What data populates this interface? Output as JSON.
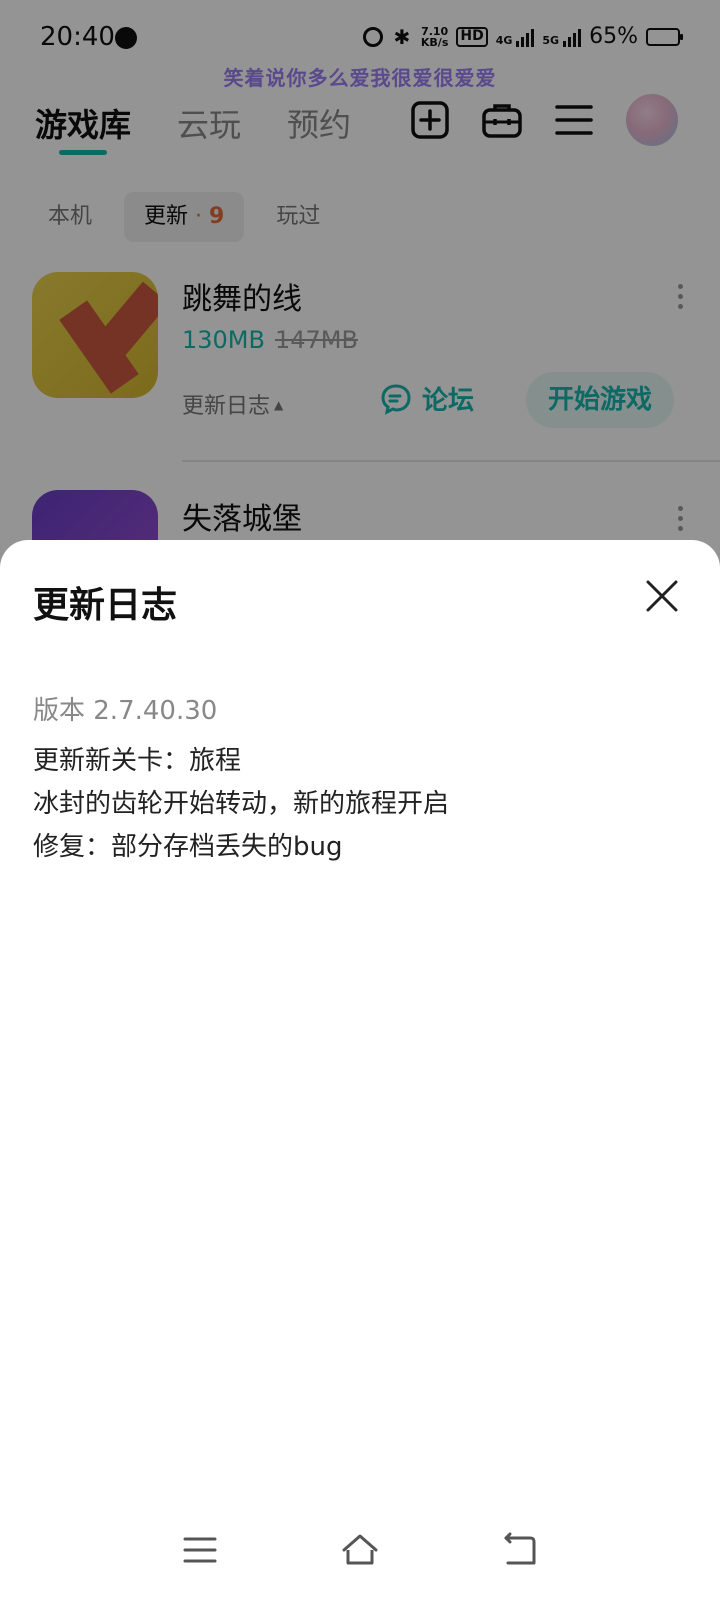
{
  "status_bar": {
    "time": "20:40",
    "network_speed_value": "7.10",
    "network_speed_unit": "KB/s",
    "hd_label": "HD",
    "sim1_label": "4G",
    "sim2_label": "5G",
    "battery_percent": "65%",
    "battery_level": 0.65
  },
  "lyric": "笑着说你多么爱我很爱很爱爱",
  "header": {
    "tabs": [
      {
        "label": "游戏库",
        "active": true
      },
      {
        "label": "云玩",
        "active": false
      },
      {
        "label": "预约",
        "active": false
      }
    ],
    "icons": [
      "add-icon",
      "toolbox-icon",
      "menu-icon"
    ]
  },
  "sub_tabs": [
    {
      "label": "本机"
    },
    {
      "label": "更新",
      "dot": "·",
      "count": "9"
    },
    {
      "label": "玩过"
    }
  ],
  "games": [
    {
      "title": "跳舞的线",
      "size": "130MB",
      "old_size": "147MB",
      "log_label": "更新日志",
      "log_caret": "▲",
      "forum_label": "论坛",
      "play_label": "开始游戏"
    },
    {
      "title": "失落城堡"
    }
  ],
  "sheet": {
    "title": "更新日志",
    "version": "版本 2.7.40.30",
    "notes": [
      "更新新关卡：旅程",
      "冰封的齿轮开始转动，新的旅程开启",
      "修复：部分存档丢失的bug"
    ]
  },
  "nav": [
    "menu-icon",
    "home-icon",
    "back-icon"
  ],
  "colors": {
    "accent": "#17b5ad",
    "badge": "#e46a3a",
    "lyric": "#9b7ff3"
  }
}
